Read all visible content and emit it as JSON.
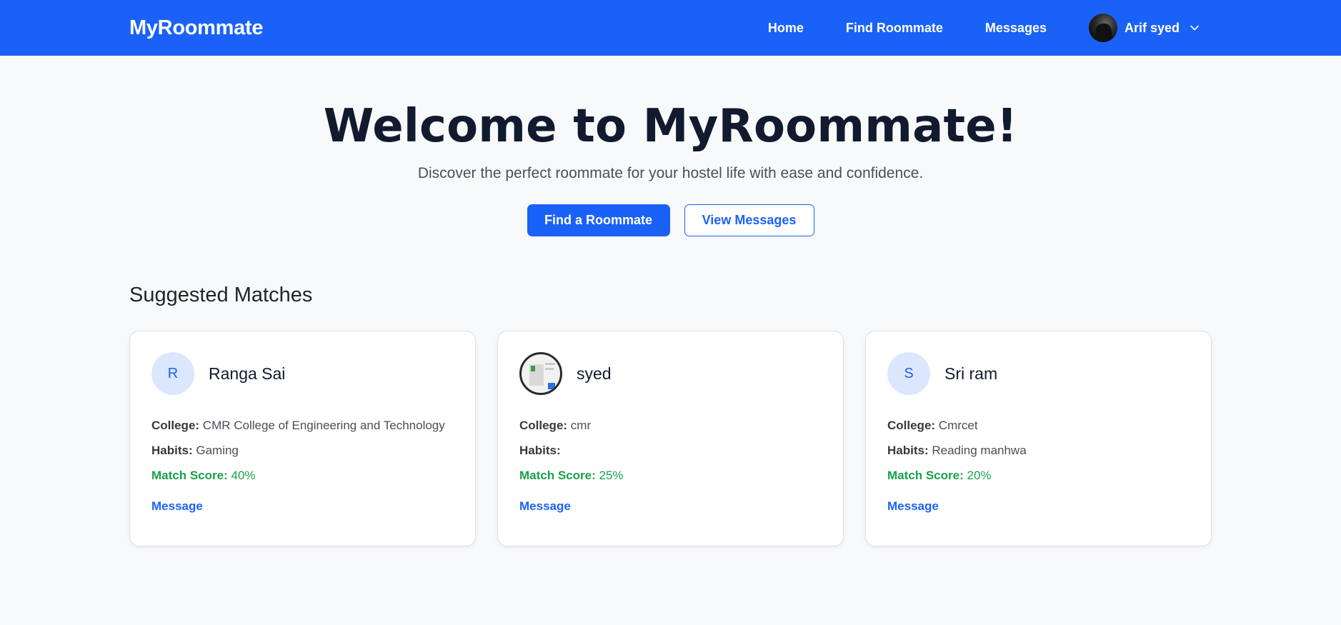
{
  "navbar": {
    "brand": "MyRoommate",
    "links": [
      "Home",
      "Find Roommate",
      "Messages"
    ],
    "user_name": "Arif syed"
  },
  "hero": {
    "title": "Welcome to MyRoommate!",
    "subtitle": "Discover the perfect roommate for your hostel life with ease and confidence.",
    "primary_button": "Find a Roommate",
    "secondary_button": "View Messages"
  },
  "matches": {
    "title": "Suggested Matches",
    "college_label": "College:",
    "habits_label": "Habits:",
    "score_label": "Match Score:",
    "message_label": "Message",
    "items": [
      {
        "initial": "R",
        "name": "Ranga Sai",
        "college": "CMR College of Engineering and Technology",
        "habits": "Gaming",
        "score": "40%",
        "has_photo": false
      },
      {
        "initial": "",
        "name": "syed",
        "college": "cmr",
        "habits": "",
        "score": "25%",
        "has_photo": true
      },
      {
        "initial": "S",
        "name": "Sri ram",
        "college": "Cmrcet",
        "habits": "Reading manhwa",
        "score": "20%",
        "has_photo": false
      }
    ]
  },
  "colors": {
    "primary": "#1a62f7",
    "success": "#16a34a",
    "background": "#f8f9fb"
  }
}
